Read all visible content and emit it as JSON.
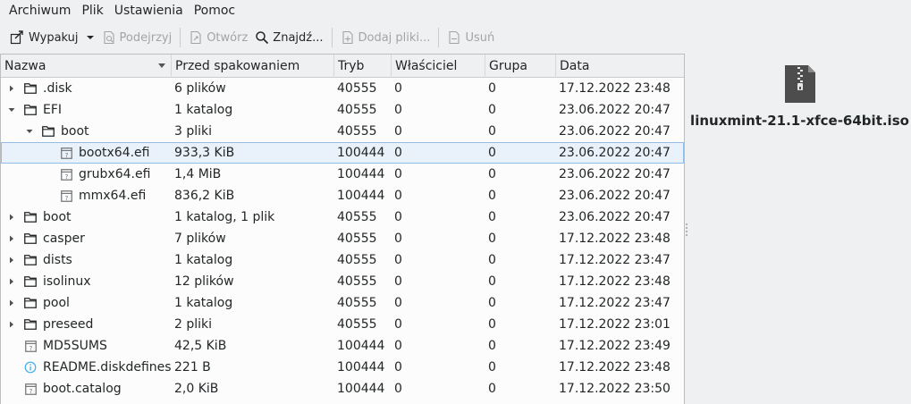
{
  "menu": [
    "Archiwum",
    "Plik",
    "Ustawienia",
    "Pomoc"
  ],
  "toolbar": {
    "extract": "Wypakuj",
    "preview": "Podejrzyj",
    "open": "Otwórz",
    "find": "Znajdź...",
    "add_files": "Dodaj pliki...",
    "remove": "Usuń"
  },
  "columns": {
    "name": "Nazwa",
    "size": "Przed spakowaniem",
    "mode": "Tryb",
    "owner": "Właściciel",
    "group": "Grupa",
    "date": "Data"
  },
  "rows": [
    {
      "name": ".disk",
      "size": "6 plików",
      "mode": "40555",
      "owner": "0",
      "group": "0",
      "date": "17.12.2022 23:48",
      "type": "folder",
      "level": 0,
      "expander": "collapsed"
    },
    {
      "name": "EFI",
      "size": "1 katalog",
      "mode": "40555",
      "owner": "0",
      "group": "0",
      "date": "23.06.2022 20:47",
      "type": "folder",
      "level": 0,
      "expander": "expanded"
    },
    {
      "name": "boot",
      "size": "3 pliki",
      "mode": "40555",
      "owner": "0",
      "group": "0",
      "date": "23.06.2022 20:47",
      "type": "folder",
      "level": 1,
      "expander": "expanded"
    },
    {
      "name": "bootx64.efi",
      "size": "933,3 KiB",
      "mode": "100444",
      "owner": "0",
      "group": "0",
      "date": "23.06.2022 20:47",
      "type": "unknown-file",
      "level": 2,
      "expander": "none",
      "selected": true
    },
    {
      "name": "grubx64.efi",
      "size": "1,4 MiB",
      "mode": "100444",
      "owner": "0",
      "group": "0",
      "date": "23.06.2022 20:47",
      "type": "unknown-file",
      "level": 2,
      "expander": "none"
    },
    {
      "name": "mmx64.efi",
      "size": "836,2 KiB",
      "mode": "100444",
      "owner": "0",
      "group": "0",
      "date": "23.06.2022 20:47",
      "type": "unknown-file",
      "level": 2,
      "expander": "none"
    },
    {
      "name": "boot",
      "size": "1 katalog, 1 plik",
      "mode": "40555",
      "owner": "0",
      "group": "0",
      "date": "23.06.2022 20:47",
      "type": "folder",
      "level": 0,
      "expander": "collapsed"
    },
    {
      "name": "casper",
      "size": "7 plików",
      "mode": "40555",
      "owner": "0",
      "group": "0",
      "date": "17.12.2022 23:48",
      "type": "folder",
      "level": 0,
      "expander": "collapsed"
    },
    {
      "name": "dists",
      "size": "1 katalog",
      "mode": "40555",
      "owner": "0",
      "group": "0",
      "date": "17.12.2022 23:47",
      "type": "folder",
      "level": 0,
      "expander": "collapsed"
    },
    {
      "name": "isolinux",
      "size": "12 plików",
      "mode": "40555",
      "owner": "0",
      "group": "0",
      "date": "17.12.2022 23:48",
      "type": "folder",
      "level": 0,
      "expander": "collapsed"
    },
    {
      "name": "pool",
      "size": "1 katalog",
      "mode": "40555",
      "owner": "0",
      "group": "0",
      "date": "17.12.2022 23:47",
      "type": "folder",
      "level": 0,
      "expander": "collapsed"
    },
    {
      "name": "preseed",
      "size": "2 pliki",
      "mode": "40555",
      "owner": "0",
      "group": "0",
      "date": "17.12.2022 23:01",
      "type": "folder",
      "level": 0,
      "expander": "collapsed"
    },
    {
      "name": "MD5SUMS",
      "size": "42,5 KiB",
      "mode": "100444",
      "owner": "0",
      "group": "0",
      "date": "17.12.2022 23:49",
      "type": "unknown-file",
      "level": 0,
      "expander": "none"
    },
    {
      "name": "README.diskdefines",
      "size": "221 B",
      "mode": "100444",
      "owner": "0",
      "group": "0",
      "date": "17.12.2022 23:48",
      "type": "info-file",
      "level": 0,
      "expander": "none"
    },
    {
      "name": "boot.catalog",
      "size": "2,0 KiB",
      "mode": "100444",
      "owner": "0",
      "group": "0",
      "date": "17.12.2022 23:50",
      "type": "unknown-file",
      "level": 0,
      "expander": "none"
    }
  ],
  "info": {
    "archive_name": "linuxmint-21.1-xfce-64bit.iso"
  },
  "colors": {
    "selection_bg": "#e9f2fa",
    "selection_border": "#93bde3",
    "info_icon": "#3daee9"
  }
}
